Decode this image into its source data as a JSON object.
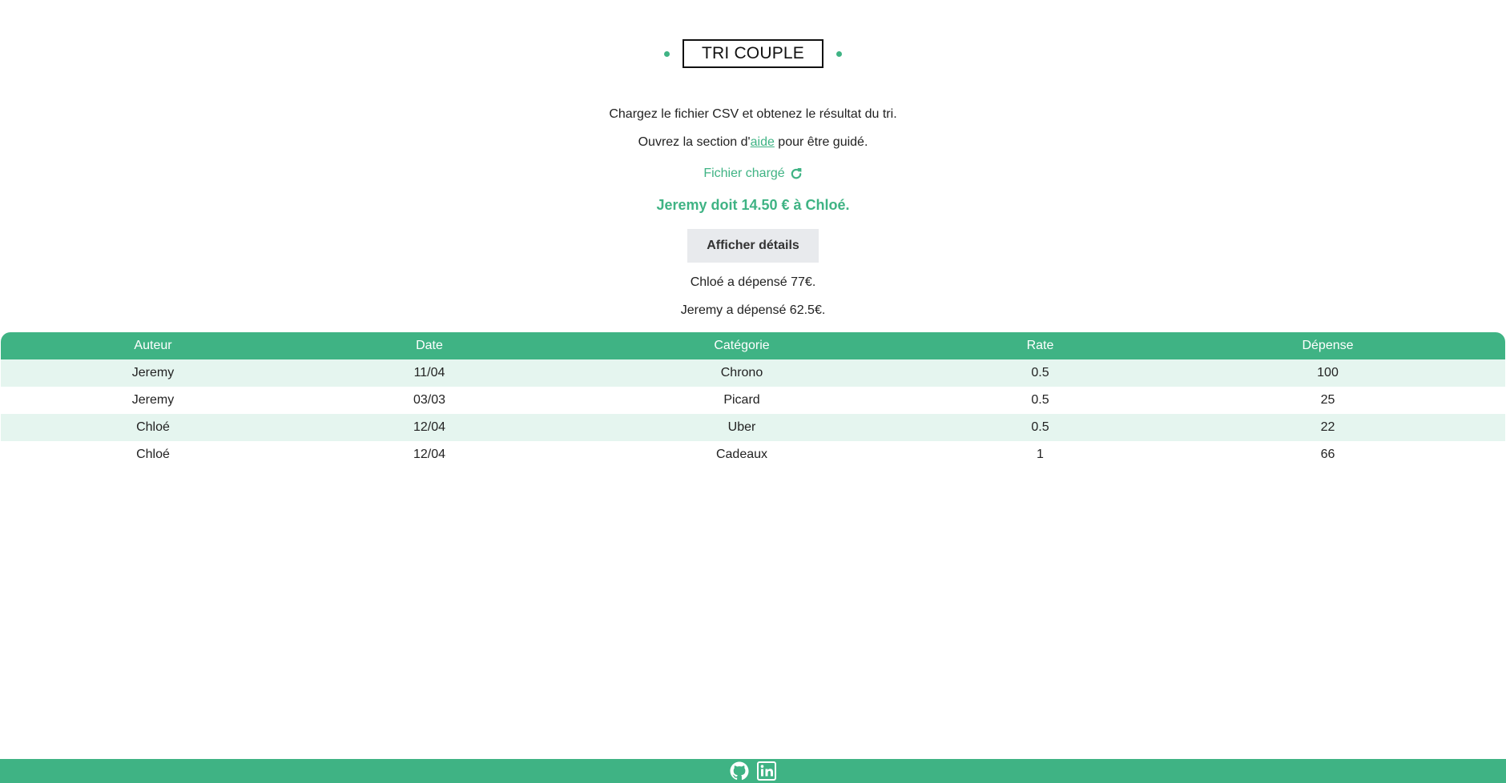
{
  "header": {
    "title": "TRI COUPLE"
  },
  "intro": {
    "text": "Chargez le fichier CSV et obtenez le résultat du tri.",
    "help_prefix": "Ouvrez la section d'",
    "help_link": "aide",
    "help_suffix": " pour être guidé."
  },
  "status": {
    "loaded_text": "Fichier chargé",
    "loaded_icon": "refresh-icon",
    "result": "Jeremy doit 14.50 € à Chloé."
  },
  "details_button": {
    "label": "Afficher détails"
  },
  "summary": {
    "spent_chloe": "Chloé a dépensé 77€.",
    "spent_jeremy": "Jeremy a dépensé 62.5€."
  },
  "table": {
    "columns": [
      "Auteur",
      "Date",
      "Catégorie",
      "Rate",
      "Dépense"
    ],
    "rows": [
      [
        "Jeremy",
        "11/04",
        "Chrono",
        "0.5",
        "100"
      ],
      [
        "Jeremy",
        "03/03",
        "Picard",
        "0.5",
        "25"
      ],
      [
        "Chloé",
        "12/04",
        "Uber",
        "0.5",
        "22"
      ],
      [
        "Chloé",
        "12/04",
        "Cadeaux",
        "1",
        "66"
      ]
    ]
  },
  "footer": {
    "icons": [
      "github-icon",
      "linkedin-icon"
    ]
  },
  "colors": {
    "accent": "#3fb384",
    "row_alt": "#e5f5ef",
    "button_bg": "#e8eaed"
  }
}
